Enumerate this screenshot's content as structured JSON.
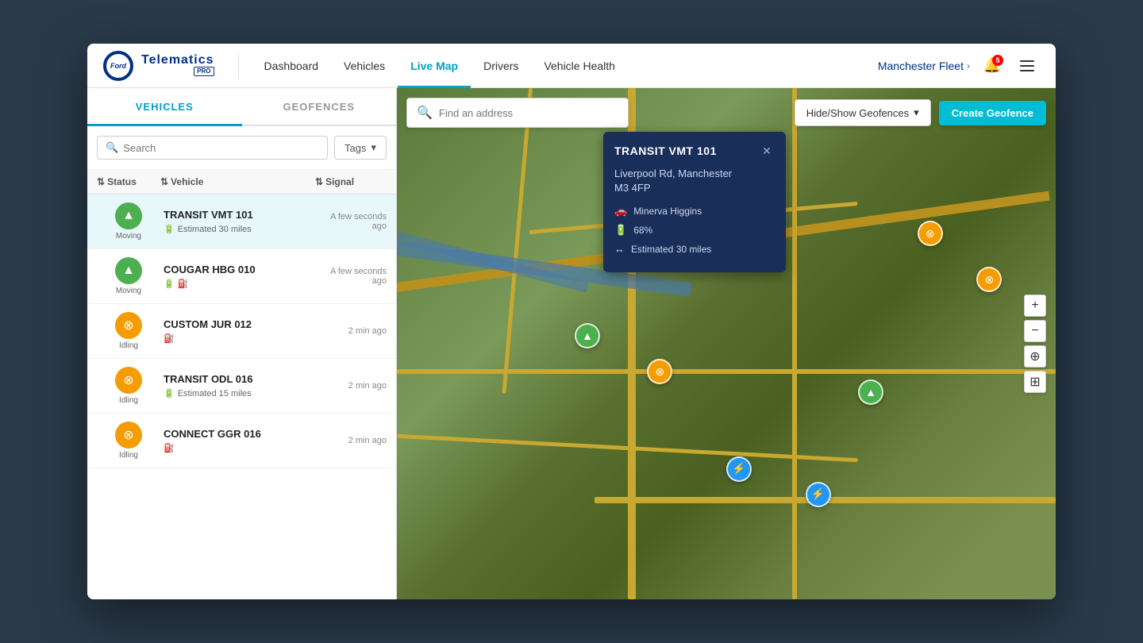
{
  "brand": {
    "logo_text": "Ford",
    "sub_text": "PRO",
    "name": "Telematics"
  },
  "nav": {
    "items": [
      {
        "label": "Dashboard",
        "active": false
      },
      {
        "label": "Vehicles",
        "active": false
      },
      {
        "label": "Live Map",
        "active": true
      },
      {
        "label": "Drivers",
        "active": false
      },
      {
        "label": "Vehicle Health",
        "active": false
      }
    ]
  },
  "header": {
    "fleet_name": "Manchester Fleet",
    "notification_count": "5"
  },
  "sidebar": {
    "tabs": [
      {
        "label": "VEHICLES",
        "active": true
      },
      {
        "label": "GEOFENCES",
        "active": false
      }
    ],
    "search_placeholder": "Search",
    "tags_label": "Tags",
    "columns": [
      {
        "label": "Status"
      },
      {
        "label": "Vehicle"
      },
      {
        "label": "Signal"
      }
    ],
    "vehicles": [
      {
        "name": "TRANSIT VMT 101",
        "status": "Moving",
        "status_type": "moving",
        "signal": "A few seconds ago",
        "meta": "Estimated 30 miles",
        "selected": true
      },
      {
        "name": "COUGAR HBG 010",
        "status": "Moving",
        "status_type": "moving",
        "signal": "A few seconds ago",
        "meta": "",
        "selected": false
      },
      {
        "name": "CUSTOM JUR 012",
        "status": "Idling",
        "status_type": "idling",
        "signal": "2 min ago",
        "meta": "",
        "selected": false
      },
      {
        "name": "TRANSIT ODL 016",
        "status": "Idling",
        "status_type": "idling",
        "signal": "2 min ago",
        "meta": "Estimated 15 miles",
        "selected": false
      },
      {
        "name": "CONNECT GGR 016",
        "status": "Idling",
        "status_type": "idling",
        "signal": "2 min ago",
        "meta": "",
        "selected": false
      }
    ]
  },
  "map": {
    "address_placeholder": "Find an address",
    "geofence_toggle_label": "Hide/Show Geofences",
    "create_geofence_label": "Create Geofence"
  },
  "popup": {
    "title": "TRANSIT VMT 101",
    "address_line1": "Liverpool Rd, Manchester",
    "address_line2": "M3 4FP",
    "driver": "Minerva Higgins",
    "battery": "68%",
    "range": "Estimated 30 miles"
  }
}
